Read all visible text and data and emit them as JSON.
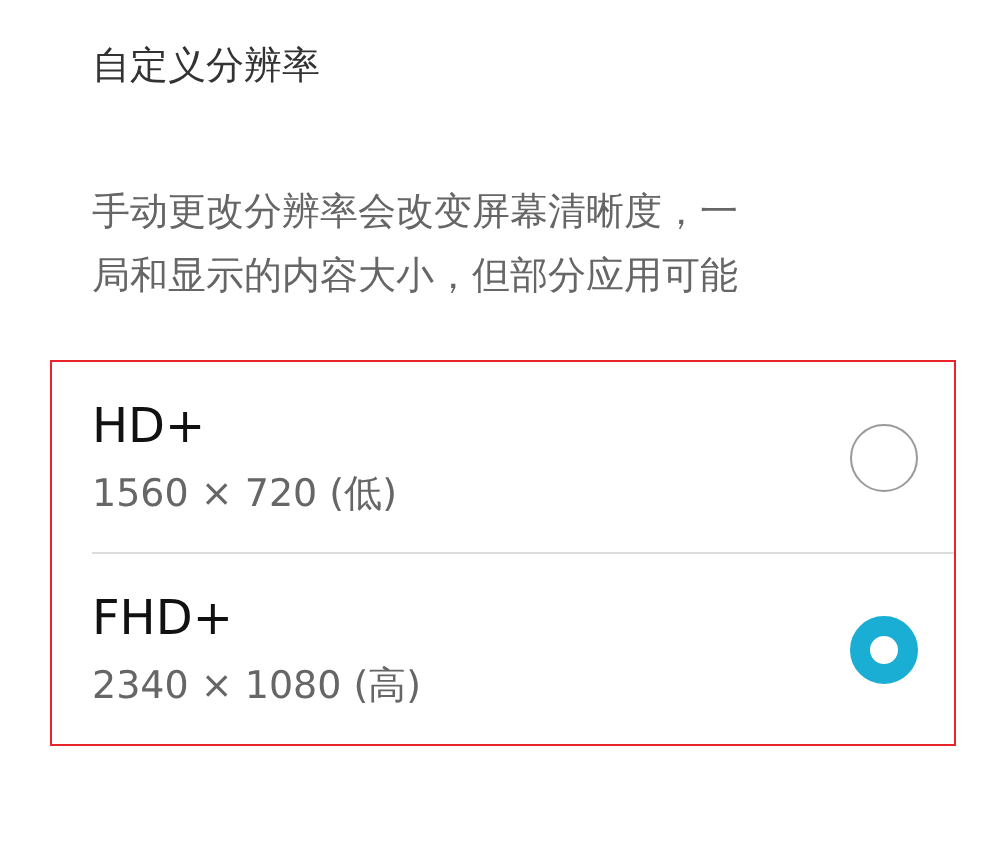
{
  "section_title": "自定义分辨率",
  "description": [
    "手动更改分辨率会改变屏幕清晰度，一",
    "局和显示的内容大小，但部分应用可能"
  ],
  "options": [
    {
      "label": "HD+",
      "resolution": "1560 × 720 (低)",
      "selected": false
    },
    {
      "label": "FHD+",
      "resolution": "2340 × 1080 (高)",
      "selected": true
    }
  ]
}
